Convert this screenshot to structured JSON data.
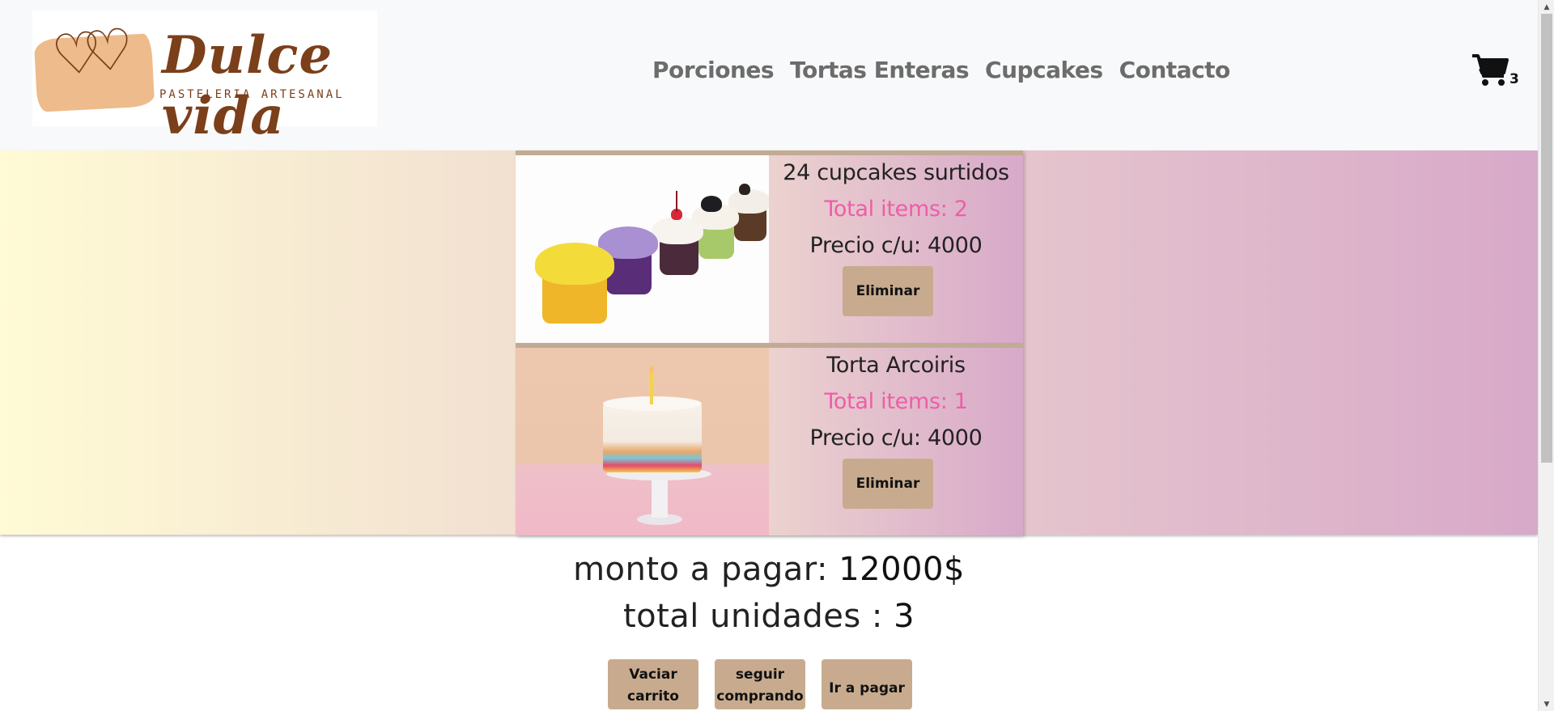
{
  "header": {
    "logo": {
      "title": "Dulce vida",
      "subtitle": "PASTELERIA ARTESANAL"
    },
    "nav": [
      {
        "label": "Porciones"
      },
      {
        "label": "Tortas Enteras"
      },
      {
        "label": "Cupcakes"
      },
      {
        "label": "Contacto"
      }
    ],
    "cart": {
      "icon": "shopping-cart-icon",
      "count": "3"
    }
  },
  "cart_items": [
    {
      "name": "24 cupcakes surtidos",
      "total_items": "Total items: 2",
      "price": "Precio c/u: 4000",
      "remove_label": "Eliminar",
      "image": "cupcakes-photo"
    },
    {
      "name": "Torta Arcoiris",
      "total_items": "Total items: 1",
      "price": "Precio c/u: 4000",
      "remove_label": "Eliminar",
      "image": "rainbow-cake-photo"
    }
  ],
  "summary": {
    "amount_label": "monto a pagar: ",
    "amount_value": "12000$",
    "units_label": "total unidades : ",
    "units_value": "3"
  },
  "actions": {
    "empty_cart_line1": "Vaciar",
    "empty_cart_line2": "carrito",
    "keep_shopping_line1": "seguir",
    "keep_shopping_line2": "comprando",
    "checkout": "Ir a pagar"
  },
  "colors": {
    "accent": "#ef5da8",
    "button": "#c8ab8e",
    "gradient_start": "#fffbd5",
    "gradient_end": "#d8a9c9",
    "brand_brown": "#7b3f1a"
  }
}
